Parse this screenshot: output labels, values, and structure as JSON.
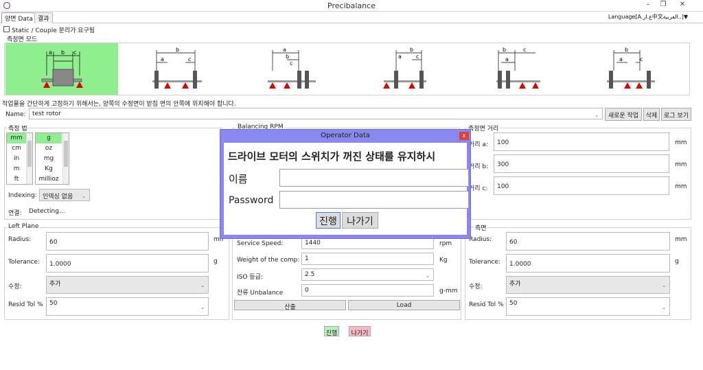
{
  "window": {
    "title": "Precibalance",
    "minimize": "–",
    "restore": "❐",
    "close": "✕"
  },
  "tabs": [
    {
      "label": "양면 Data"
    },
    {
      "label": "결과"
    }
  ],
  "language": "Language[A.ع.ار中文العربية..]▼",
  "static_couple": {
    "label": "Static / Couple 분리가 요구됨",
    "checked": false
  },
  "mode_title": "측정면 모드",
  "notice": "작업물을 간단하게 고정하기 위해서는, 양쪽의 수정면이 받침 면의 안쪽에 위치해야 합니다.",
  "name": {
    "label": "Name:",
    "value": "test rotor"
  },
  "top_buttons": {
    "new": "새로운 작업",
    "delete": "삭제",
    "log": "로그 보기"
  },
  "units": {
    "title": "측정 법",
    "length": [
      "mm",
      "cm",
      "in",
      "m",
      "ft"
    ],
    "weight": [
      "g",
      "oz",
      "mg",
      "Kg",
      "millioz"
    ],
    "length_selected": "mm",
    "weight_selected": "g"
  },
  "indexing": {
    "label": "Indexing:",
    "value": "인덱싱 없음"
  },
  "connection": {
    "label": "연결:",
    "value": "Detecting..."
  },
  "balancing_rpm": "Balancing RPM",
  "distance": {
    "title": "측정면 거리",
    "rows": [
      {
        "label": "거리 a:",
        "value": "100",
        "unit": "mm"
      },
      {
        "label": "거리 b:",
        "value": "300",
        "unit": "mm"
      },
      {
        "label": "거리 c:",
        "value": "100",
        "unit": "mm"
      }
    ]
  },
  "left_plane": {
    "title": "Left Plane",
    "radius_label": "Radius:",
    "radius": "60",
    "radius_unit": "mm",
    "tol_label": "Tolerance:",
    "tol": "1.0000",
    "tol_unit": "g",
    "fix_label": "수정:",
    "fix": "추가",
    "resid_label": "Resid Tol %",
    "resid": "50"
  },
  "right_plane": {
    "title": "측면",
    "radius_label": "Radius:",
    "radius": "60",
    "radius_unit": "mm",
    "tol_label": "Tolerance:",
    "tol": "1.0000",
    "tol_unit": "g",
    "fix_label": "수정:",
    "fix": "추가",
    "resid_label": "Resid Tol %",
    "resid": "50"
  },
  "center": {
    "rows": [
      {
        "label": "Service Speed:",
        "value": "1440",
        "unit": "rpm"
      },
      {
        "label": "Weight of the comp:",
        "value": "1",
        "unit": "Kg"
      },
      {
        "label": "ISO 등급:",
        "value": "2.5",
        "unit": ""
      },
      {
        "label": "잔류 Unbalance",
        "value": "0",
        "unit": "g-mm"
      }
    ],
    "calc": "산출",
    "load": "Load"
  },
  "bottom": {
    "proceed": "진행",
    "exit": "나가기"
  },
  "dialog": {
    "title": "Operator Data",
    "close": "x",
    "warning": "드라이브 모터의 스위치가 꺼진 상태를 유지하시",
    "name_label": "이름",
    "name_value": "",
    "pw_label": "Password",
    "pw_value": "",
    "proceed": "진행",
    "exit": "나가기"
  },
  "colors": {
    "selected_mode": "#90ee90",
    "dialog_frame": "#8a87ee",
    "proceed": "#b8f0b8",
    "exit": "#f5b8c4",
    "support": "#e00000"
  }
}
